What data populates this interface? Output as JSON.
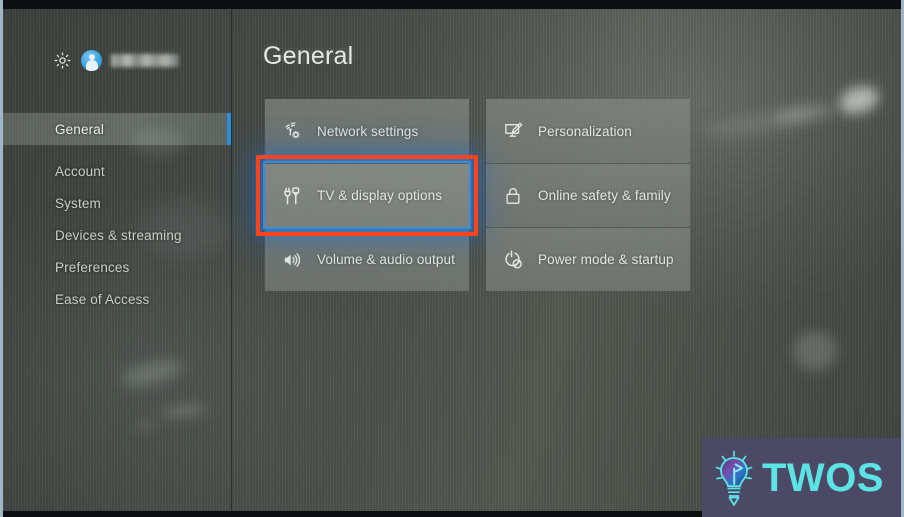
{
  "device": {
    "platform_ui": "Xbox Settings",
    "screen_title": "General"
  },
  "sidebar": {
    "profile": {
      "gear_icon": "gear-icon",
      "avatar_icon": "user-avatar-icon",
      "gamertag_redacted": ""
    },
    "items": [
      {
        "label": "General",
        "selected": true
      },
      {
        "label": "Account",
        "selected": false
      },
      {
        "label": "System",
        "selected": false
      },
      {
        "label": "Devices & streaming",
        "selected": false
      },
      {
        "label": "Preferences",
        "selected": false
      },
      {
        "label": "Ease of Access",
        "selected": false
      }
    ]
  },
  "main": {
    "title": "General",
    "columns": [
      {
        "tiles": [
          {
            "label": "Network settings",
            "icon": "network-wifi-gear-icon",
            "focused": false
          },
          {
            "label": "TV & display options",
            "icon": "tv-cable-plug-icon",
            "focused": true,
            "annotated": true
          },
          {
            "label": "Volume & audio output",
            "icon": "speaker-volume-icon",
            "focused": false
          }
        ]
      },
      {
        "tiles": [
          {
            "label": "Personalization",
            "icon": "monitor-pencil-icon",
            "focused": false
          },
          {
            "label": "Online safety & family",
            "icon": "padlock-icon",
            "focused": false
          },
          {
            "label": "Power mode & startup",
            "icon": "power-leaf-icon",
            "focused": false
          }
        ]
      }
    ]
  },
  "annotation": {
    "highlight_color": "#f9431f",
    "focus_glow_color": "#3a8ad8",
    "target_label": "TV & display options"
  },
  "watermark": {
    "brand": "TWOS",
    "icon": "lightbulb-icon",
    "background_color": "#4b4966",
    "text_color": "#5ce4e4"
  },
  "colors": {
    "sidebar_selected_accent": "#2a8fe0",
    "tile_background": "#7a807b",
    "screen_background": "#474c48",
    "text_primary": "#e3e7e2"
  }
}
